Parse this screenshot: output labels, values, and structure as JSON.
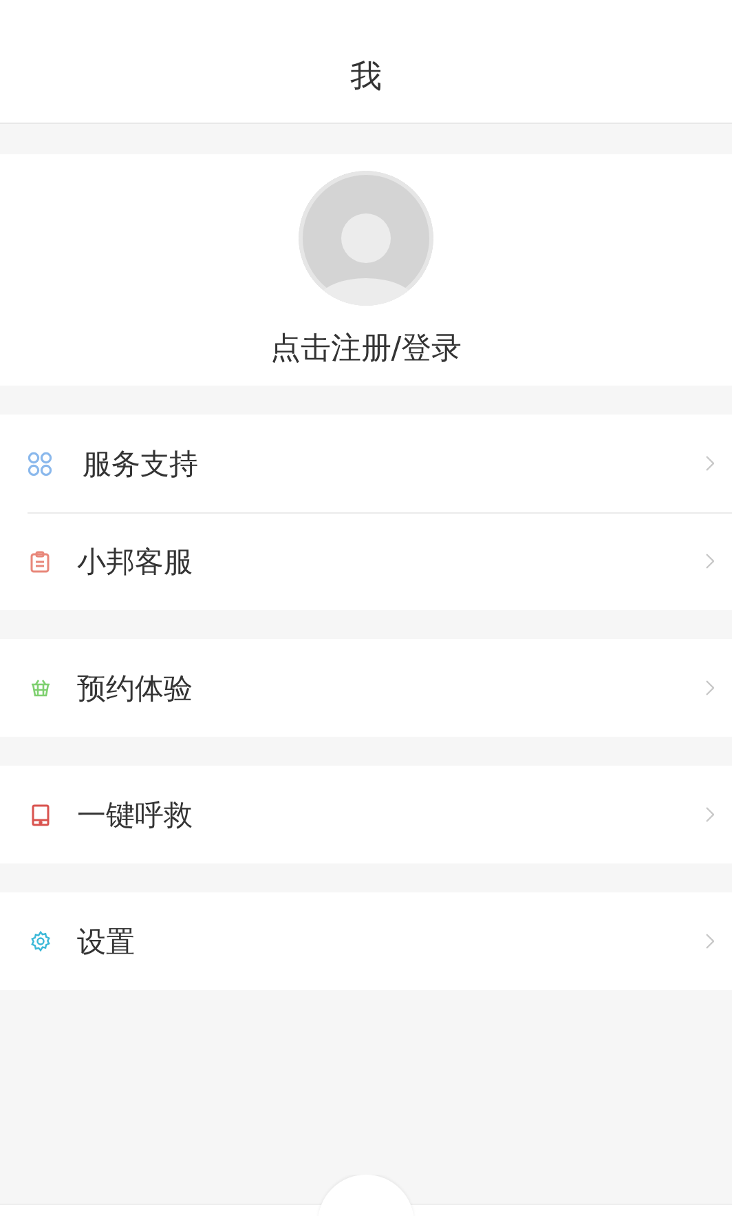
{
  "header": {
    "title": "我"
  },
  "profile": {
    "login_text": "点击注册/登录"
  },
  "menu_groups": [
    {
      "items": [
        {
          "label": "服务支持",
          "kind": "grid"
        },
        {
          "label": "小邦客服",
          "kind": "clipboard"
        }
      ]
    },
    {
      "items": [
        {
          "label": "预约体验",
          "kind": "basket"
        }
      ]
    },
    {
      "items": [
        {
          "label": "一键呼救",
          "kind": "tablet"
        }
      ]
    },
    {
      "items": [
        {
          "label": "设置",
          "kind": "gear"
        }
      ]
    }
  ]
}
